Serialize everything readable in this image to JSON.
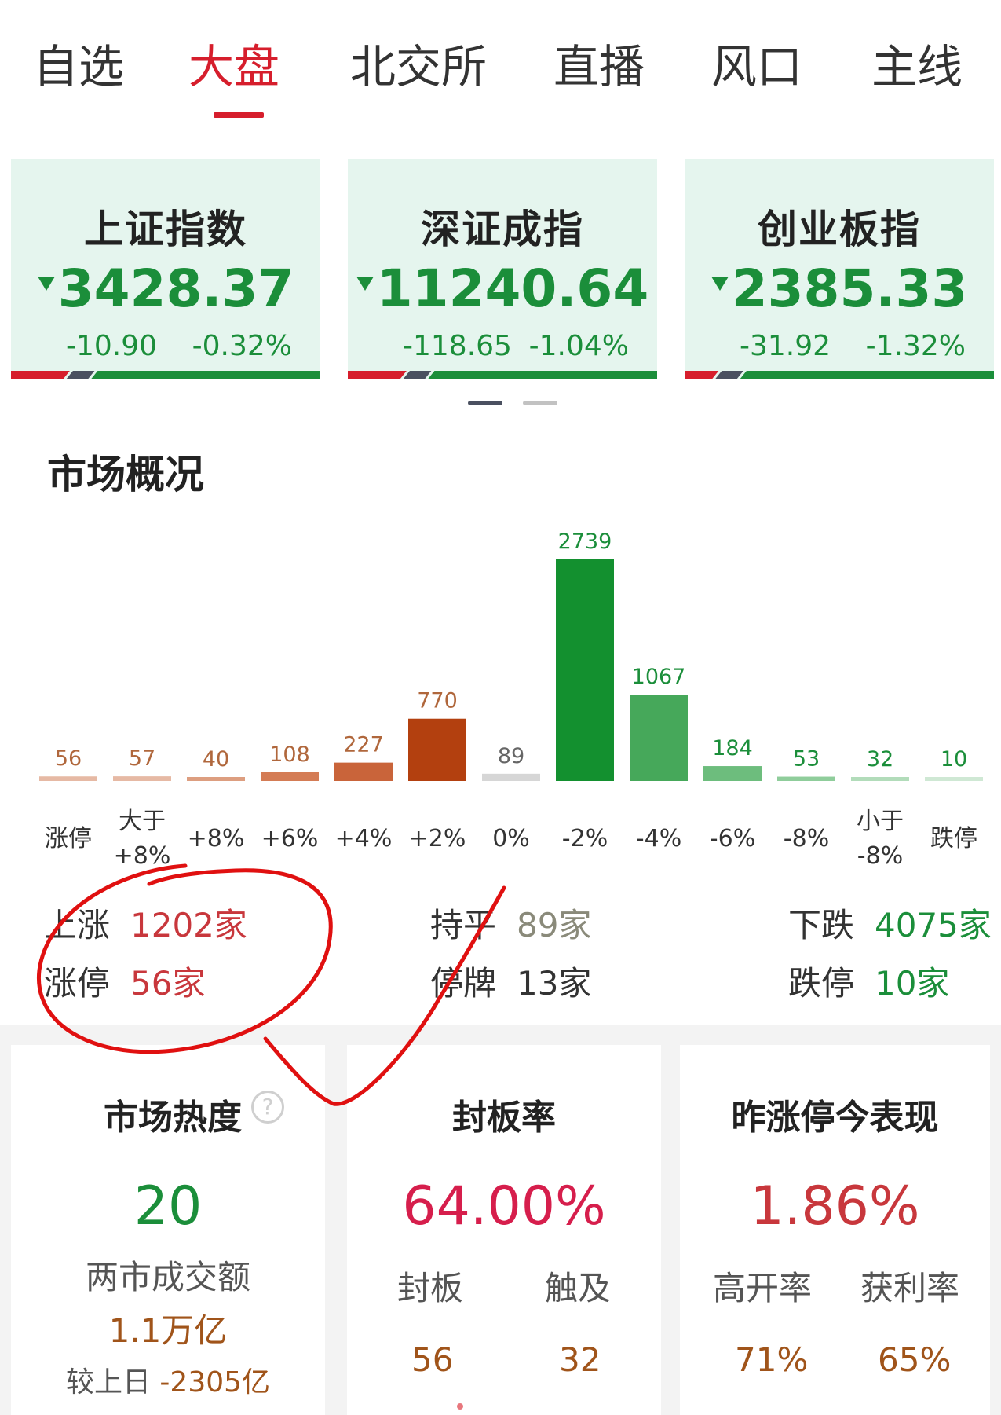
{
  "nav": {
    "tabs": [
      "自选",
      "大盘",
      "北交所",
      "直播",
      "风口",
      "主线"
    ],
    "active_index": 1
  },
  "indices": [
    {
      "name": "上证指数",
      "value": "3428.37",
      "change": "-10.90",
      "change_pct": "-0.32%",
      "direction": "down",
      "up_share": 0.19,
      "flat_share": 0.08
    },
    {
      "name": "深证成指",
      "value": "11240.64",
      "change": "-118.65",
      "change_pct": "-1.04%",
      "direction": "down",
      "up_share": 0.19,
      "flat_share": 0.08
    },
    {
      "name": "创业板指",
      "value": "2385.33",
      "change": "-31.92",
      "change_pct": "-1.32%",
      "direction": "down",
      "up_share": 0.11,
      "flat_share": 0.08
    }
  ],
  "pager": {
    "count": 2,
    "active_index": 0
  },
  "market": {
    "title": "市场概况",
    "stats": {
      "up_label": "上涨",
      "up_value": "1202家",
      "flat_label": "持平",
      "flat_value": "89家",
      "down_label": "下跌",
      "down_value": "4075家",
      "limit_up_label": "涨停",
      "limit_up_value": "56家",
      "suspended_label": "停牌",
      "suspended_value": "13家",
      "limit_down_label": "跌停",
      "limit_down_value": "10家"
    }
  },
  "chart_data": {
    "type": "bar",
    "categories": [
      "涨停",
      "大于\n+8%",
      "+8%",
      "+6%",
      "+4%",
      "+2%",
      "0%",
      "-2%",
      "-4%",
      "-6%",
      "-8%",
      "小于\n-8%",
      "跌停"
    ],
    "values": [
      56,
      57,
      40,
      108,
      227,
      770,
      89,
      2739,
      1067,
      184,
      53,
      32,
      10
    ],
    "colors": [
      "#e6b9a4",
      "#e6b9a4",
      "#dd9e80",
      "#d47c55",
      "#c9643a",
      "#b3400f",
      "#d6d6d6",
      "#13902f",
      "#46a85a",
      "#6dbd7d",
      "#8fcd9b",
      "#b2dcba",
      "#cfe8d4"
    ],
    "label_colors": [
      "#b0673c",
      "#b0673c",
      "#b0673c",
      "#b0673c",
      "#b0673c",
      "#b0673c",
      "#666666",
      "#1b8e3a",
      "#1b8e3a",
      "#1b8e3a",
      "#1b8e3a",
      "#1b8e3a",
      "#1b8e3a"
    ],
    "ylim": [
      0,
      2739
    ],
    "title": "",
    "xlabel": "",
    "ylabel": ""
  },
  "cards": {
    "heat": {
      "title": "市场热度",
      "help": "?",
      "value": "20",
      "turnover_label": "两市成交额",
      "turnover_value": "1.1万亿",
      "compare_label": "较上日",
      "compare_value": "-2305亿"
    },
    "seal": {
      "title": "封板率",
      "value": "64.00%",
      "seal_label": "封板",
      "touch_label": "触及",
      "seal_value": "56",
      "touch_value": "32"
    },
    "yesterday": {
      "title": "昨涨停今表现",
      "value": "1.86%",
      "high_open_label": "高开率",
      "profit_label": "获利率",
      "high_open_value": "71%",
      "profit_value": "65%"
    }
  },
  "colors": {
    "red": "#d61e2c",
    "green": "#1b8e3a",
    "card_green_bg": "#e5f5ee"
  }
}
